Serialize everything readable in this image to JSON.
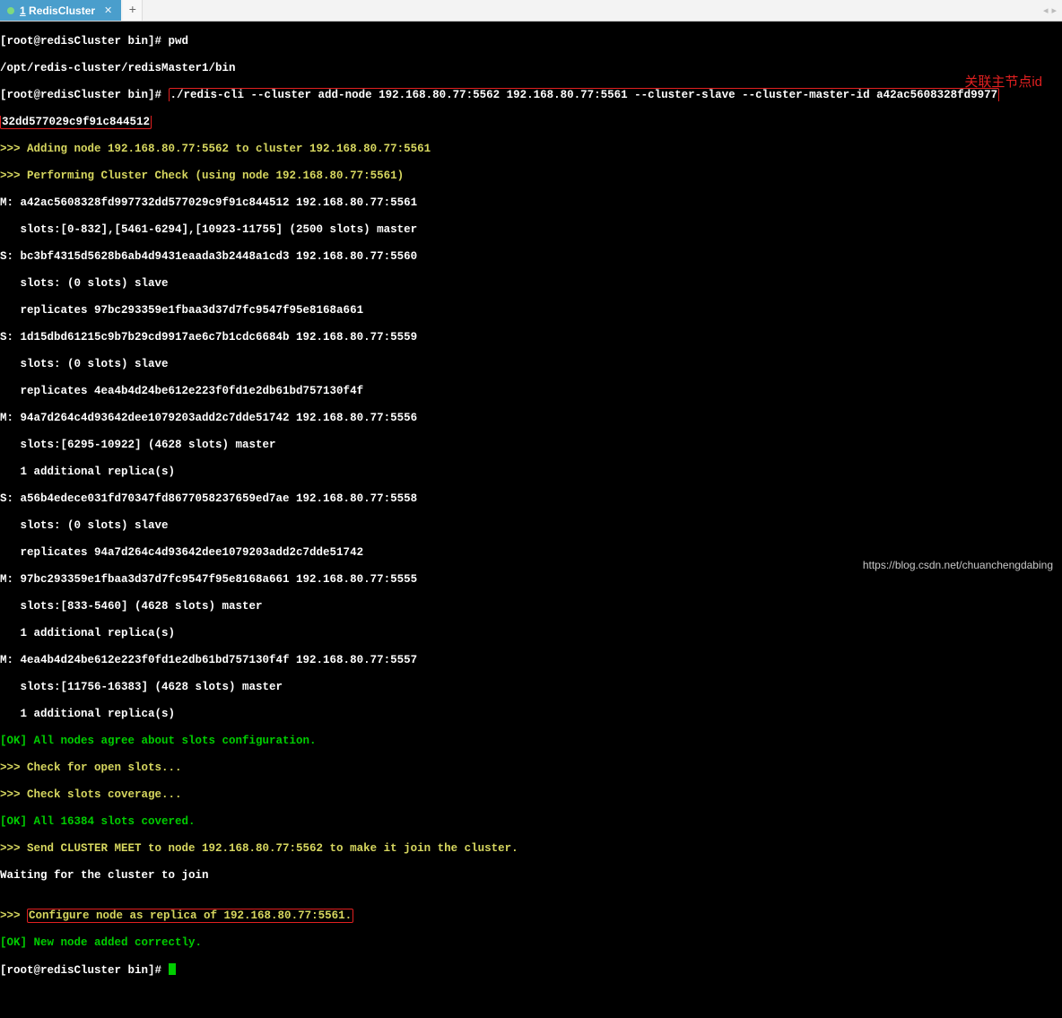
{
  "tab": {
    "label_underline": "1",
    "label_rest": " RedisCluster"
  },
  "annotation_red": "关联主节点id",
  "watermark": "https://blog.csdn.net/chuanchengdabing",
  "lines": {
    "l1a": "[root@redisCluster bin]# ",
    "l1b": "pwd",
    "l2": "/opt/redis-cluster/redisMaster1/bin",
    "l3a": "[root@redisCluster bin]# ",
    "l3b": "./redis-cli --cluster add-node 192.168.80.77:5562 192.168.80.77:5561 --cluster-slave --cluster-master-id a42ac5608328fd9977",
    "l3c": "32dd577029c9f91c844512",
    "l4": ">>> Adding node 192.168.80.77:5562 to cluster 192.168.80.77:5561",
    "l5": ">>> Performing Cluster Check (using node 192.168.80.77:5561)",
    "l6": "M: a42ac5608328fd997732dd577029c9f91c844512 192.168.80.77:5561",
    "l7": "   slots:[0-832],[5461-6294],[10923-11755] (2500 slots) master",
    "l8": "S: bc3bf4315d5628b6ab4d9431eaada3b2448a1cd3 192.168.80.77:5560",
    "l9": "   slots: (0 slots) slave",
    "l10": "   replicates 97bc293359e1fbaa3d37d7fc9547f95e8168a661",
    "l11": "S: 1d15dbd61215c9b7b29cd9917ae6c7b1cdc6684b 192.168.80.77:5559",
    "l12": "   slots: (0 slots) slave",
    "l13": "   replicates 4ea4b4d24be612e223f0fd1e2db61bd757130f4f",
    "l14": "M: 94a7d264c4d93642dee1079203add2c7dde51742 192.168.80.77:5556",
    "l15": "   slots:[6295-10922] (4628 slots) master",
    "l16": "   1 additional replica(s)",
    "l17": "S: a56b4edece031fd70347fd8677058237659ed7ae 192.168.80.77:5558",
    "l18": "   slots: (0 slots) slave",
    "l19": "   replicates 94a7d264c4d93642dee1079203add2c7dde51742",
    "l20": "M: 97bc293359e1fbaa3d37d7fc9547f95e8168a661 192.168.80.77:5555",
    "l21": "   slots:[833-5460] (4628 slots) master",
    "l22": "   1 additional replica(s)",
    "l23": "M: 4ea4b4d24be612e223f0fd1e2db61bd757130f4f 192.168.80.77:5557",
    "l24": "   slots:[11756-16383] (4628 slots) master",
    "l25": "   1 additional replica(s)",
    "l26": "[OK] All nodes agree about slots configuration.",
    "l27": ">>> Check for open slots...",
    "l28": ">>> Check slots coverage...",
    "l29": "[OK] All 16384 slots covered.",
    "l30": ">>> Send CLUSTER MEET to node 192.168.80.77:5562 to make it join the cluster.",
    "l31": "Waiting for the cluster to join",
    "l32": "",
    "l33a": ">>> ",
    "l33b": "Configure node as replica of 192.168.80.77:5561.",
    "l34": "[OK] New node added correctly.",
    "l35": "[root@redisCluster bin]# "
  }
}
